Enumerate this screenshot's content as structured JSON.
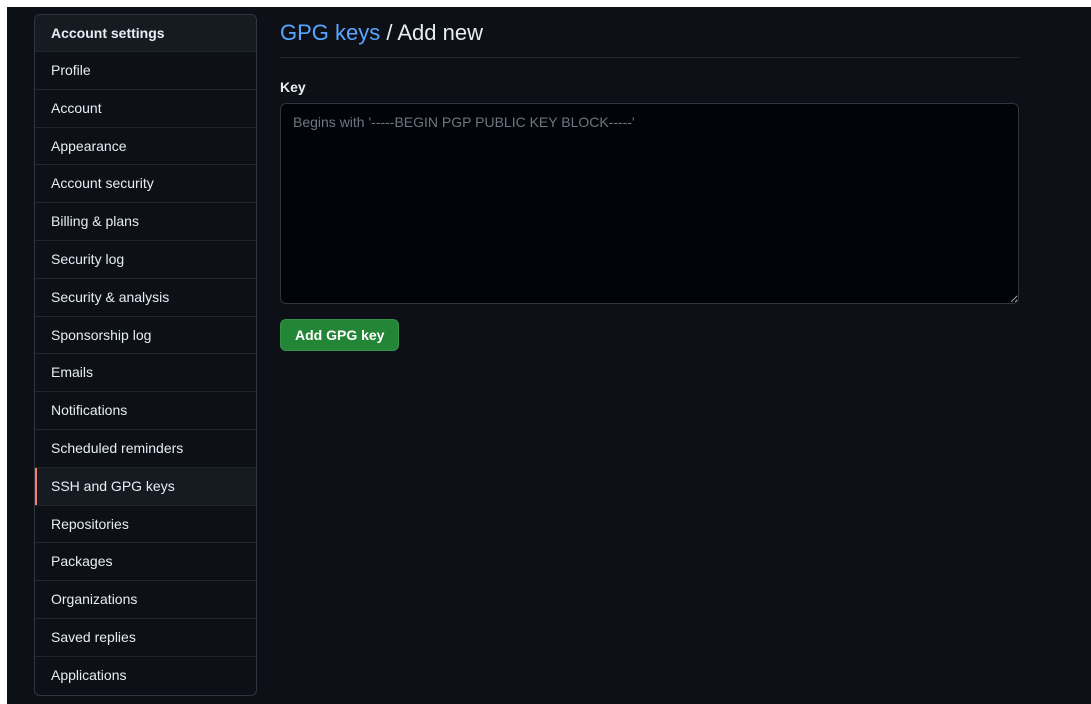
{
  "sidebar": {
    "header": "Account settings",
    "items": [
      {
        "label": "Profile"
      },
      {
        "label": "Account"
      },
      {
        "label": "Appearance"
      },
      {
        "label": "Account security"
      },
      {
        "label": "Billing & plans"
      },
      {
        "label": "Security log"
      },
      {
        "label": "Security & analysis"
      },
      {
        "label": "Sponsorship log"
      },
      {
        "label": "Emails"
      },
      {
        "label": "Notifications"
      },
      {
        "label": "Scheduled reminders"
      },
      {
        "label": "SSH and GPG keys",
        "selected": true
      },
      {
        "label": "Repositories"
      },
      {
        "label": "Packages"
      },
      {
        "label": "Organizations"
      },
      {
        "label": "Saved replies"
      },
      {
        "label": "Applications"
      }
    ]
  },
  "main": {
    "title_link": "GPG keys",
    "title_rest": " / Add new",
    "key_label": "Key",
    "key_value": "",
    "key_placeholder": "Begins with '-----BEGIN PGP PUBLIC KEY BLOCK-----'",
    "add_button_label": "Add GPG key"
  },
  "colors": {
    "background": "#0d1117",
    "accent_link": "#58a6ff",
    "selected_indicator": "#f78166",
    "primary_button": "#238636"
  }
}
